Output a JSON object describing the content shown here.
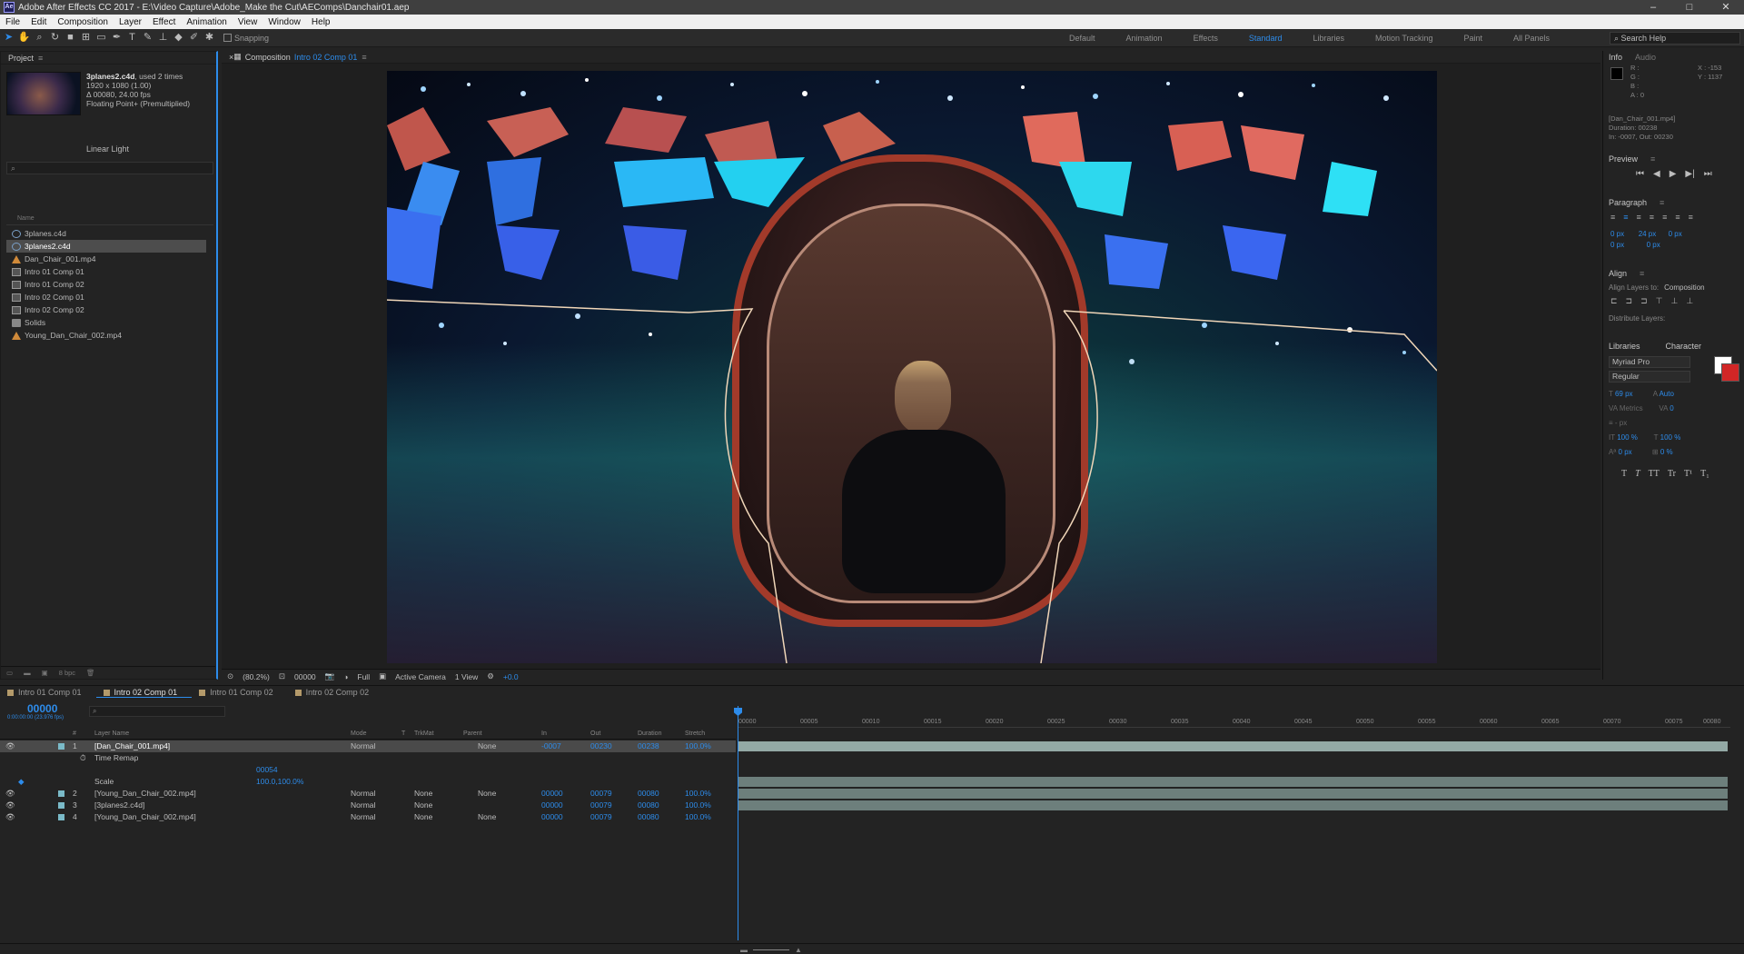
{
  "titlebar": {
    "title": "Adobe After Effects CC 2017 - E:\\Video Capture\\Adobe_Make the Cut\\AEComps\\Danchair01.aep",
    "logo": "Ae",
    "minimize": "–",
    "maximize": "□",
    "close": "✕"
  },
  "menu": [
    "File",
    "Edit",
    "Composition",
    "Layer",
    "Effect",
    "Animation",
    "View",
    "Window",
    "Help"
  ],
  "toolbar": {
    "snapping": "Snapping",
    "workspaces": [
      "Default",
      "Animation",
      "Effects",
      "Standard",
      "Libraries",
      "Motion Tracking",
      "Paint",
      "All Panels"
    ],
    "active_workspace": "Standard",
    "search_placeholder": "Search Help"
  },
  "project": {
    "tab": "Project",
    "selected_name": "3planes2.c4d",
    "used": ", used 2 times",
    "dims": "1920 x 1080 (1.00)",
    "fps": "Δ 00080, 24.00 fps",
    "depth": "Floating Point+ (Premultiplied)",
    "blend": "Linear Light",
    "column_name": "Name",
    "items": [
      {
        "name": "3planes.c4d",
        "type": "c4d"
      },
      {
        "name": "3planes2.c4d",
        "type": "c4d",
        "selected": true
      },
      {
        "name": "Dan_Chair_001.mp4",
        "type": "mp4"
      },
      {
        "name": "Intro 01 Comp 01",
        "type": "comp"
      },
      {
        "name": "Intro 01 Comp 02",
        "type": "comp"
      },
      {
        "name": "Intro 02 Comp 01",
        "type": "comp"
      },
      {
        "name": "Intro 02 Comp 02",
        "type": "comp"
      },
      {
        "name": "Solids",
        "type": "folder"
      },
      {
        "name": "Young_Dan_Chair_002.mp4",
        "type": "mp4"
      }
    ],
    "footer_bpc": "8 bpc"
  },
  "composition": {
    "tab_prefix": "Composition",
    "tab_name": "Intro 02 Comp 01",
    "footer": {
      "zoom": "(80.2%)",
      "timecode": "00000",
      "resolution": "Full",
      "camera": "Active Camera",
      "views": "1 View",
      "exposure": "+0.0"
    }
  },
  "info": {
    "tab": "Info",
    "tab2": "Audio",
    "r": "R :",
    "g": "G :",
    "b": "B :",
    "a": "A : 0",
    "x": "X : -153",
    "y": "Y : 1137",
    "meta1": "[Dan_Chair_001.mp4]",
    "meta2": "Duration: 00238",
    "meta3": "In: -0007, Out: 00230"
  },
  "preview": {
    "title": "Preview"
  },
  "paragraph": {
    "title": "Paragraph",
    "indent1": "0 px",
    "indent2": "24 px",
    "indent3": "0 px",
    "space1": "0 px",
    "space2": "0 px"
  },
  "align": {
    "title": "Align",
    "label": "Align Layers to:",
    "target": "Composition",
    "distribute": "Distribute Layers:"
  },
  "character": {
    "libraries_tab": "Libraries",
    "tab": "Character",
    "font": "Myriad Pro",
    "style": "Regular",
    "size": "69 px",
    "leading": "Auto",
    "kerning": "Metrics",
    "tracking": "0",
    "stroke": "- px",
    "vscale": "100 %",
    "hscale": "100 %",
    "baseline": "0 px",
    "tsume": "0 %",
    "styles": [
      "T",
      "T",
      "TT",
      "Tr",
      "T¹",
      "T₁"
    ],
    "fill_color": "#ffffff",
    "stroke_color": "#d12626"
  },
  "timeline": {
    "tabs": [
      "Intro 01 Comp 01",
      "Intro 02 Comp 01",
      "Intro 01 Comp 02",
      "Intro 02 Comp 02"
    ],
    "active_tab": "Intro 02 Comp 01",
    "timecode": "00000",
    "timecode_sub": "0:00:00:00 (23.976 fps)",
    "columns": {
      "num": "#",
      "layer_name": "Layer Name",
      "mode": "Mode",
      "t": "T",
      "trkmat": "TrkMat",
      "parent": "Parent",
      "in": "In",
      "out": "Out",
      "duration": "Duration",
      "stretch": "Stretch"
    },
    "layers": [
      {
        "num": "1",
        "name": "[Dan_Chair_001.mp4]",
        "mode": "Normal",
        "trkmat": "",
        "parent": "None",
        "in": "-0007",
        "out": "00230",
        "duration": "00238",
        "stretch": "100.0%",
        "selected": true
      },
      {
        "num": "",
        "name": "Time Remap",
        "value": "00054"
      },
      {
        "num": "",
        "name": "Scale",
        "value": "100.0,100.0%"
      },
      {
        "num": "2",
        "name": "[Young_Dan_Chair_002.mp4]",
        "mode": "Normal",
        "trkmat": "None",
        "parent": "None",
        "in": "00000",
        "out": "00079",
        "duration": "00080",
        "stretch": "100.0%"
      },
      {
        "num": "3",
        "name": "[3planes2.c4d]",
        "mode": "Normal",
        "trkmat": "None",
        "parent": "",
        "in": "00000",
        "out": "00079",
        "duration": "00080",
        "stretch": "100.0%"
      },
      {
        "num": "4",
        "name": "[Young_Dan_Chair_002.mp4]",
        "mode": "Normal",
        "trkmat": "None",
        "parent": "None",
        "in": "00000",
        "out": "00079",
        "duration": "00080",
        "stretch": "100.0%"
      }
    ],
    "ruler_labels": [
      "00000",
      "00005",
      "00010",
      "00015",
      "00020",
      "00025",
      "00030",
      "00035",
      "00040",
      "00045",
      "00050",
      "00055",
      "00060",
      "00065",
      "00070",
      "00075",
      "00080"
    ]
  }
}
